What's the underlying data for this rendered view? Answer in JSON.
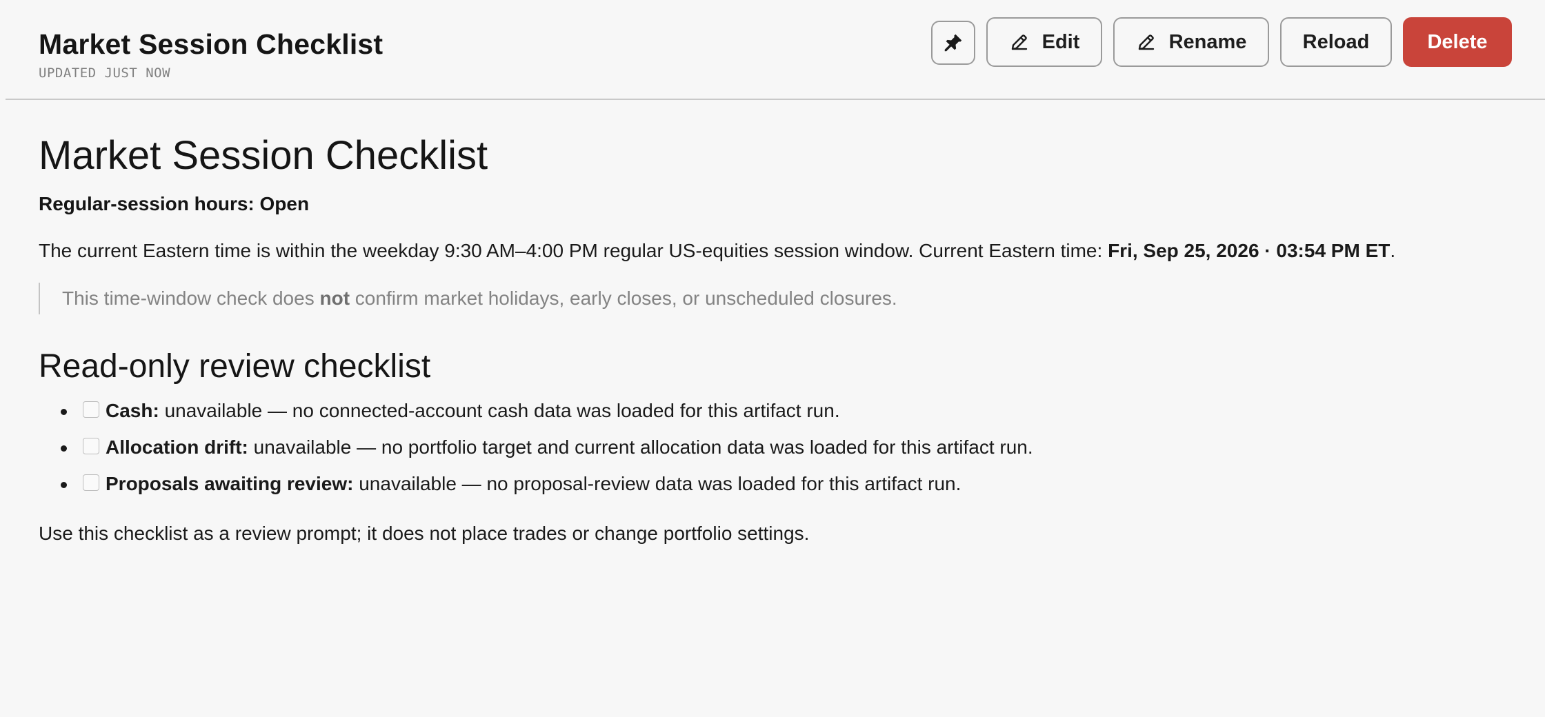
{
  "header": {
    "title": "Market Session Checklist",
    "updated": "UPDATED JUST NOW",
    "buttons": {
      "pin_icon": "pin-icon",
      "edit_label": "Edit",
      "edit_icon": "pencil-icon",
      "rename_label": "Rename",
      "rename_icon": "pencil-icon",
      "reload_label": "Reload",
      "delete_label": "Delete"
    },
    "colors": {
      "delete_bg": "#c9443a"
    }
  },
  "document": {
    "title": "Market Session Checklist",
    "status": "Regular-session hours: Open",
    "intro_text": "The current Eastern time is within the weekday 9:30 AM–4:00 PM regular US-equities session window. Current Eastern time: ",
    "intro_time": "Fri, Sep 25, 2026 · 03:54 PM ET",
    "intro_end": ".",
    "note_before": "This time-window check does ",
    "note_bold": "not",
    "note_after": " confirm market holidays, early closes, or unscheduled closures.",
    "section_title": "Read-only review checklist",
    "checklist": [
      {
        "label": "Cash:",
        "text": " unavailable — no connected-account cash data was loaded for this artifact run.",
        "checked": false
      },
      {
        "label": "Allocation drift:",
        "text": " unavailable — no portfolio target and current allocation data was loaded for this artifact run.",
        "checked": false
      },
      {
        "label": "Proposals awaiting review:",
        "text": " unavailable — no proposal-review data was loaded for this artifact run.",
        "checked": false
      }
    ],
    "footer_note": "Use this checklist as a review prompt; it does not place trades or change portfolio settings."
  }
}
